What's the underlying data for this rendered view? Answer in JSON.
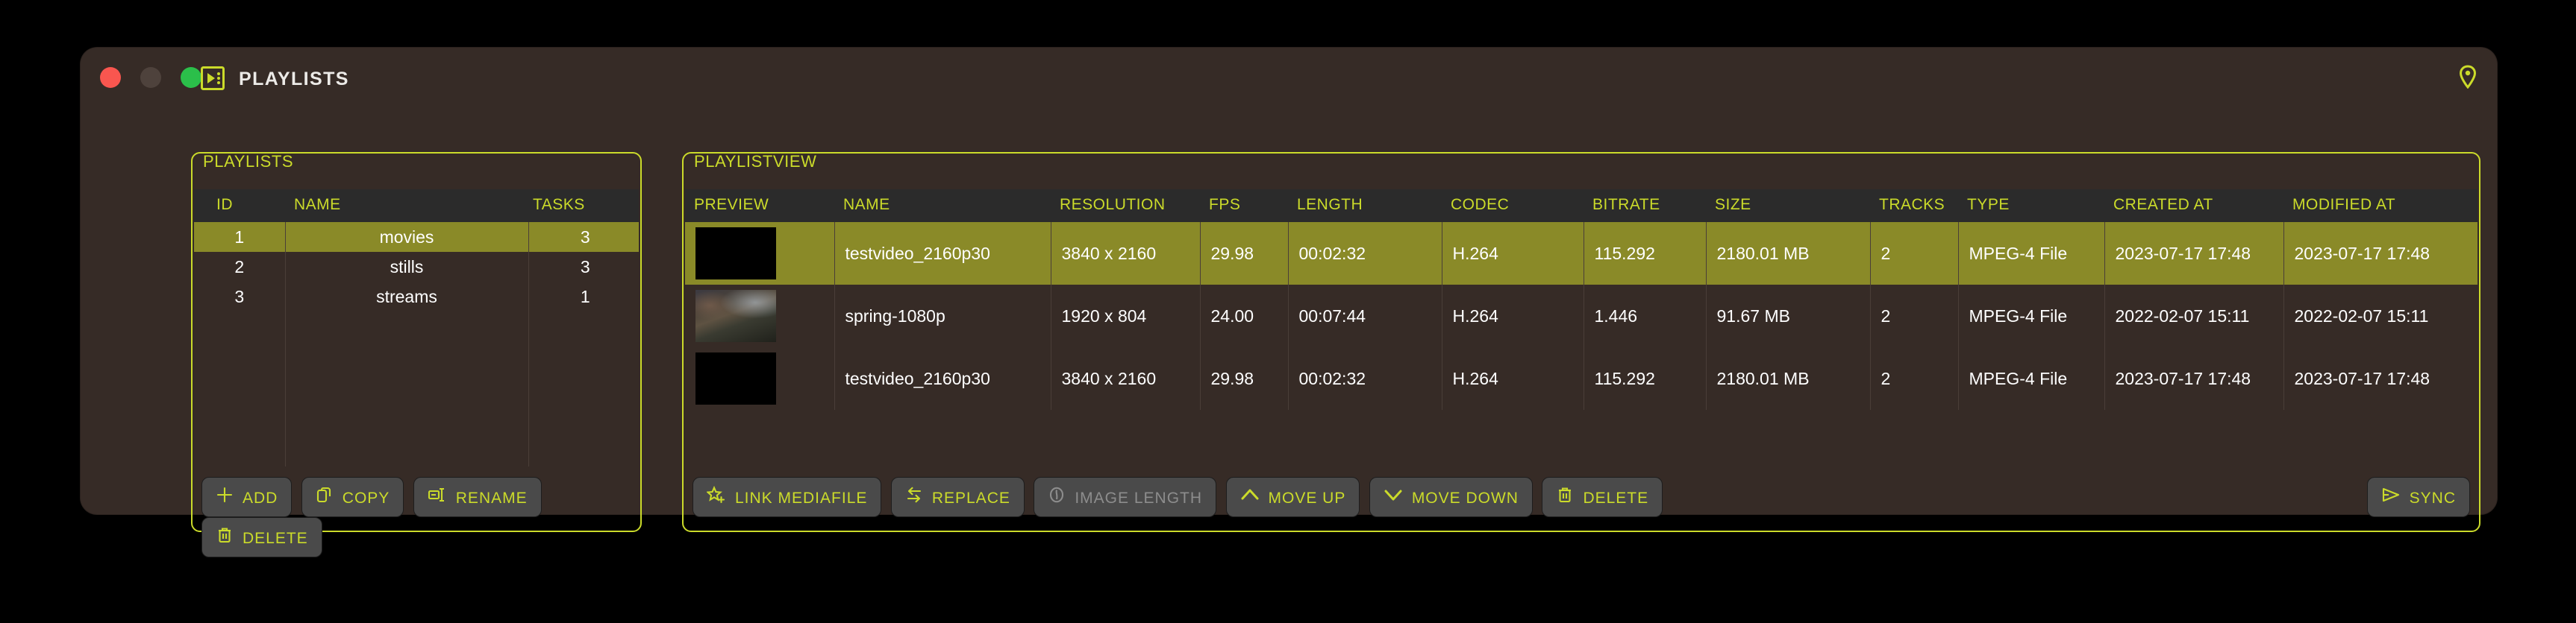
{
  "window": {
    "title": "PLAYLISTS",
    "app_icon": "playlist-app-icon",
    "pin_icon": "location-pin-icon",
    "controls": {
      "close": "close-button",
      "minimize": "minimize-button",
      "maximize": "maximize-button"
    }
  },
  "colors": {
    "accent": "#cbdb2a",
    "window_bg": "#362b26",
    "header_bg": "#2b2b2b",
    "selection": "#8a8a28",
    "text": "#ffffff",
    "button_bg": "#4a4a4a",
    "disabled_text": "#8d8d8d"
  },
  "playlists_panel": {
    "title": "PLAYLISTS",
    "columns": [
      "ID",
      "NAME",
      "TASKS"
    ],
    "rows": [
      {
        "id": "1",
        "name": "movies",
        "tasks": "3",
        "selected": true
      },
      {
        "id": "2",
        "name": "stills",
        "tasks": "3",
        "selected": false
      },
      {
        "id": "3",
        "name": "streams",
        "tasks": "1",
        "selected": false
      }
    ],
    "buttons": [
      {
        "label": "ADD",
        "icon": "plus-icon",
        "disabled": false
      },
      {
        "label": "COPY",
        "icon": "copy-icon",
        "disabled": false
      },
      {
        "label": "RENAME",
        "icon": "rename-icon",
        "disabled": false
      },
      {
        "label": "DELETE",
        "icon": "trash-icon",
        "disabled": false
      }
    ]
  },
  "playlistview_panel": {
    "title": "PLAYLISTVIEW",
    "columns": [
      "PREVIEW",
      "NAME",
      "RESOLUTION",
      "FPS",
      "LENGTH",
      "CODEC",
      "BITRATE",
      "SIZE",
      "TRACKS",
      "TYPE",
      "CREATED AT",
      "MODIFIED AT"
    ],
    "rows": [
      {
        "preview": "black-thumbnail",
        "name": "testvideo_2160p30",
        "resolution": "3840 x 2160",
        "fps": "29.98",
        "length": "00:02:32",
        "codec": "H.264",
        "bitrate": "115.292",
        "size": "2180.01 MB",
        "tracks": "2",
        "type": "MPEG-4 File",
        "created_at": "2023-07-17 17:48",
        "modified_at": "2023-07-17 17:48",
        "selected": true
      },
      {
        "preview": "landscape-thumbnail",
        "name": "spring-1080p",
        "resolution": "1920 x 804",
        "fps": "24.00",
        "length": "00:07:44",
        "codec": "H.264",
        "bitrate": "1.446",
        "size": "91.67 MB",
        "tracks": "2",
        "type": "MPEG-4 File",
        "created_at": "2022-02-07 15:11",
        "modified_at": "2022-02-07 15:11",
        "selected": false
      },
      {
        "preview": "black-thumbnail",
        "name": "testvideo_2160p30",
        "resolution": "3840 x 2160",
        "fps": "29.98",
        "length": "00:02:32",
        "codec": "H.264",
        "bitrate": "115.292",
        "size": "2180.01 MB",
        "tracks": "2",
        "type": "MPEG-4 File",
        "created_at": "2023-07-17 17:48",
        "modified_at": "2023-07-17 17:48",
        "selected": false
      }
    ],
    "buttons": [
      {
        "label": "LINK MEDIAFILE",
        "icon": "star-plus-icon",
        "disabled": false
      },
      {
        "label": "REPLACE",
        "icon": "swap-arrows-icon",
        "disabled": false
      },
      {
        "label": "IMAGE LENGTH",
        "icon": "clock-icon",
        "disabled": true
      },
      {
        "label": "MOVE UP",
        "icon": "chevron-up-icon",
        "disabled": false
      },
      {
        "label": "MOVE DOWN",
        "icon": "chevron-down-icon",
        "disabled": false
      },
      {
        "label": "DELETE",
        "icon": "trash-icon",
        "disabled": false
      }
    ],
    "sync_button": {
      "label": "SYNC",
      "icon": "send-icon",
      "disabled": false
    }
  }
}
